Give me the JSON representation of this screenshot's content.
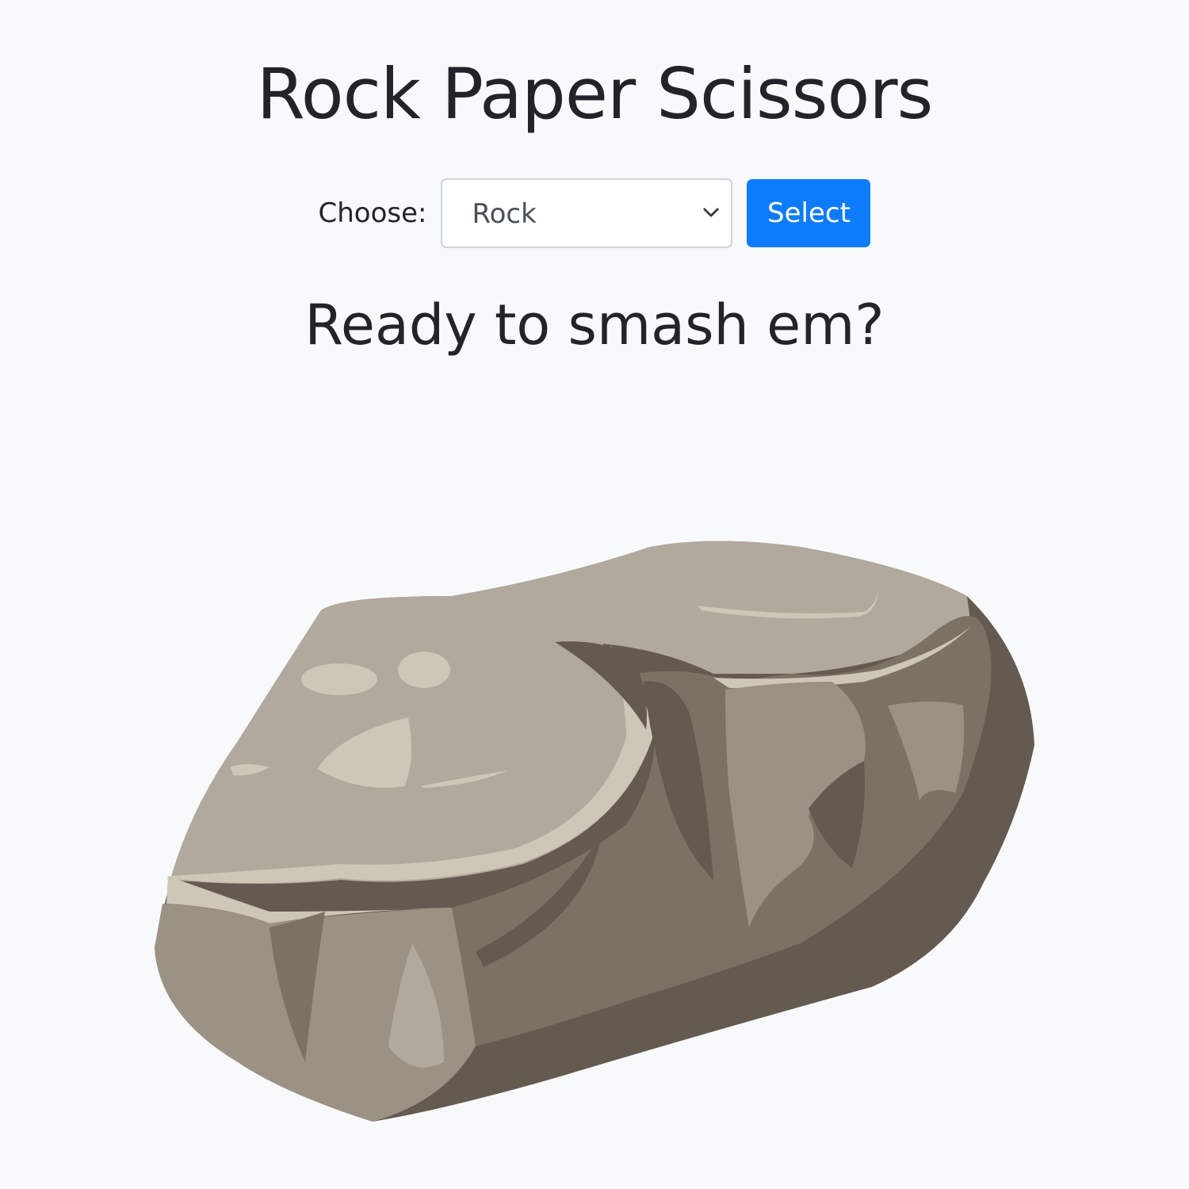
{
  "header": {
    "title": "Rock Paper Scissors"
  },
  "controls": {
    "choose_label": "Choose:",
    "select_value": "Rock",
    "select_button_label": "Select"
  },
  "main": {
    "prompt": "Ready to smash em?",
    "image_icon": "rock-image"
  },
  "colors": {
    "background": "#f8f9fb",
    "text": "#212529",
    "button": "#0d7bfd",
    "select_border": "#ced4da"
  }
}
